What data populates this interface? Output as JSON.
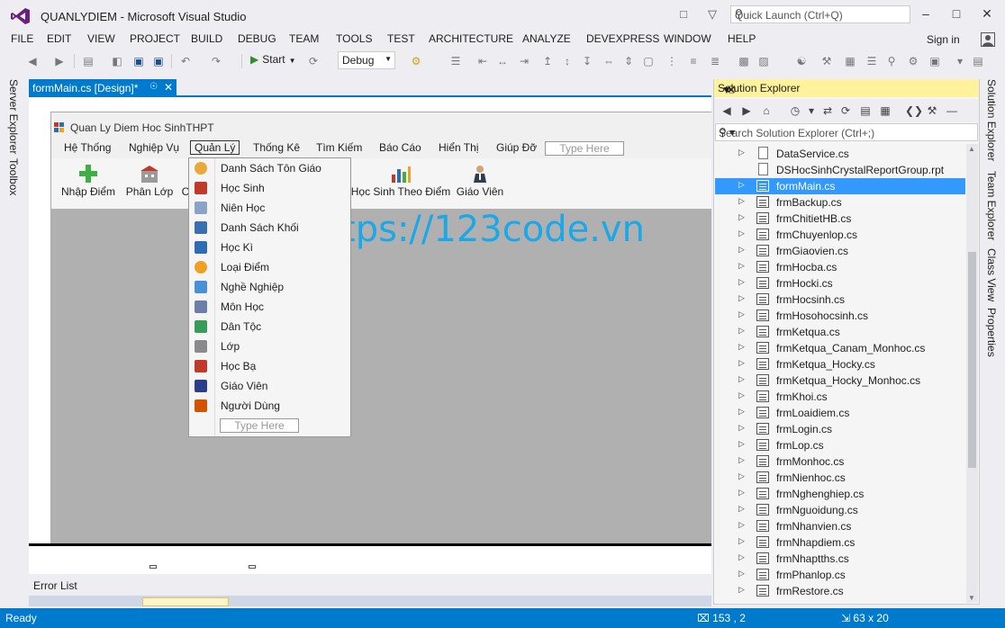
{
  "window": {
    "title": "QUANLYDIEM - Microsoft Visual Studio",
    "quick_launch_placeholder": "Quick Launch (Ctrl+Q)",
    "controls": [
      "minimize",
      "maximize",
      "close"
    ]
  },
  "menu": {
    "items": [
      "FILE",
      "EDIT",
      "VIEW",
      "PROJECT",
      "BUILD",
      "DEBUG",
      "TEAM",
      "TOOLS",
      "TEST",
      "ARCHITECTURE",
      "ANALYZE",
      "DEVEXPRESS",
      "WINDOW",
      "HELP"
    ],
    "sign_in": "Sign in"
  },
  "toolbar": {
    "start_label": "Start",
    "config": "Debug"
  },
  "left_tabs": [
    "Server Explorer",
    "Toolbox"
  ],
  "document_tab": {
    "label": "formMain.cs [Design]*"
  },
  "form": {
    "title": "Quan Ly Diem Hoc SinhTHPT",
    "menu": [
      "Hệ Thống",
      "Nghiệp Vụ",
      "Quản Lý",
      "Thống Kê",
      "Tìm Kiếm",
      "Báo Cáo",
      "Hiển Thị",
      "Giúp Đỡ"
    ],
    "menu_type_here": "Type Here",
    "toolbar_buttons": [
      {
        "label": "Nhập Điểm",
        "icon": "plus-icon"
      },
      {
        "label": "Phân Lớp",
        "icon": "building-icon"
      },
      {
        "label": "C",
        "icon": ""
      },
      {
        "label": "Học Sinh Theo Điểm",
        "icon": "bar-chart-icon"
      },
      {
        "label": "Giáo Viên",
        "icon": "teacher-icon"
      }
    ],
    "watermark": "https://123code.vn"
  },
  "dropdown": {
    "items": [
      {
        "label": "Danh Sách Tôn Giáo",
        "icon": "person-icon",
        "color": "#e8a93a"
      },
      {
        "label": "Học Sinh",
        "icon": "students-icon",
        "color": "#c0392b"
      },
      {
        "label": "Niên Học",
        "icon": "calendar-icon",
        "color": "#8aa4c8"
      },
      {
        "label": "Danh Sách Khối",
        "icon": "books-icon",
        "color": "#3a6fb0"
      },
      {
        "label": "Học Kì",
        "icon": "book-icon",
        "color": "#2e6db4"
      },
      {
        "label": "Loại Điểm",
        "icon": "globe-icon",
        "color": "#f0a020"
      },
      {
        "label": "Nghề Nghiệp",
        "icon": "monitor-icon",
        "color": "#4a90d9"
      },
      {
        "label": "Môn Học",
        "icon": "list-icon",
        "color": "#6d7fa8"
      },
      {
        "label": "Dân Tộc",
        "icon": "chart-icon",
        "color": "#3a9a5a"
      },
      {
        "label": "Lớp",
        "icon": "building-icon",
        "color": "#8a8a8a"
      },
      {
        "label": "Học Bạ",
        "icon": "record-icon",
        "color": "#c0392b"
      },
      {
        "label": "Giáo Viên",
        "icon": "teacher-icon",
        "color": "#2c3e8a"
      },
      {
        "label": "Người Dùng",
        "icon": "users-icon",
        "color": "#d35400"
      }
    ],
    "type_here": "Type Here"
  },
  "error_list": {
    "title": "Error List"
  },
  "solution_explorer": {
    "title": "Solution Explorer",
    "search_placeholder": "Search Solution Explorer (Ctrl+;)",
    "files": [
      {
        "name": "DataService.cs",
        "type": "code"
      },
      {
        "name": "DSHocSinhCrystalReportGroup.rpt",
        "type": "doc"
      },
      {
        "name": "formMain.cs",
        "type": "form",
        "selected": true
      },
      {
        "name": "frmBackup.cs",
        "type": "form"
      },
      {
        "name": "frmChitietHB.cs",
        "type": "form"
      },
      {
        "name": "frmChuyenlop.cs",
        "type": "form"
      },
      {
        "name": "frmGiaovien.cs",
        "type": "form"
      },
      {
        "name": "frmHocba.cs",
        "type": "form"
      },
      {
        "name": "frmHocki.cs",
        "type": "form"
      },
      {
        "name": "frmHocsinh.cs",
        "type": "form"
      },
      {
        "name": "frmHosohocsinh.cs",
        "type": "form"
      },
      {
        "name": "frmKetqua.cs",
        "type": "form"
      },
      {
        "name": "frmKetqua_Canam_Monhoc.cs",
        "type": "form"
      },
      {
        "name": "frmKetqua_Hocky.cs",
        "type": "form"
      },
      {
        "name": "frmKetqua_Hocky_Monhoc.cs",
        "type": "form"
      },
      {
        "name": "frmKhoi.cs",
        "type": "form"
      },
      {
        "name": "frmLoaidiem.cs",
        "type": "form"
      },
      {
        "name": "frmLogin.cs",
        "type": "form"
      },
      {
        "name": "frmLop.cs",
        "type": "form"
      },
      {
        "name": "frmMonhoc.cs",
        "type": "form"
      },
      {
        "name": "frmNienhoc.cs",
        "type": "form"
      },
      {
        "name": "frmNghenghiep.cs",
        "type": "form"
      },
      {
        "name": "frmNguoidung.cs",
        "type": "form"
      },
      {
        "name": "frmNhanvien.cs",
        "type": "form"
      },
      {
        "name": "frmNhapdiem.cs",
        "type": "form"
      },
      {
        "name": "frmNhaptths.cs",
        "type": "form"
      },
      {
        "name": "frmPhanlop.cs",
        "type": "form"
      },
      {
        "name": "frmRestore.cs",
        "type": "form"
      }
    ]
  },
  "right_tabs": [
    "Solution Explorer",
    "Team Explorer",
    "Class View",
    "Properties"
  ],
  "status": {
    "ready": "Ready",
    "position": "153 , 2",
    "size": "63 x 20"
  },
  "colors": {
    "accent": "#007acc",
    "vs_purple": "#68217a",
    "selection": "#3399ff",
    "watermark": "#1aa8e8"
  }
}
